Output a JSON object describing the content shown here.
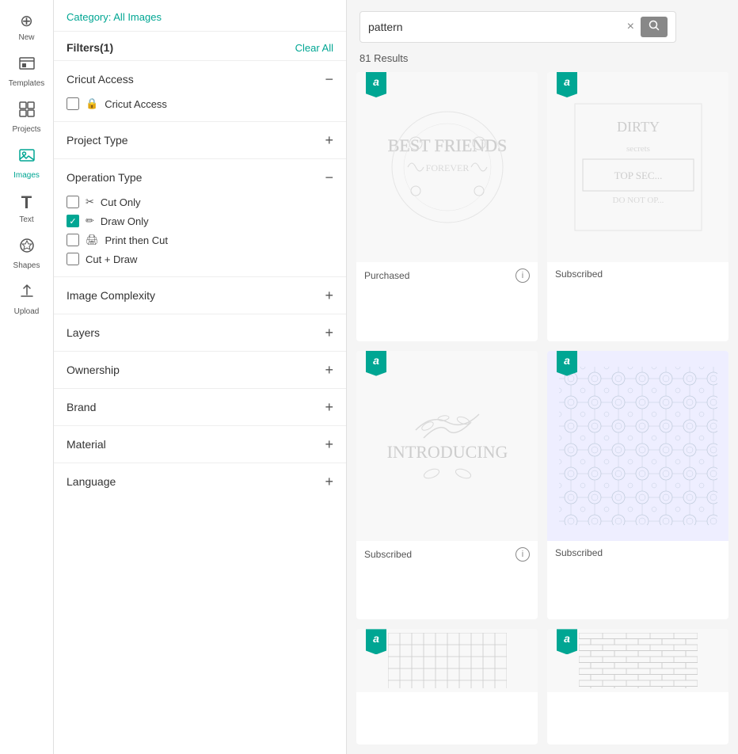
{
  "sidebar": {
    "items": [
      {
        "id": "new",
        "label": "New",
        "icon": "⊕",
        "active": false
      },
      {
        "id": "templates",
        "label": "Templates",
        "icon": "👕",
        "active": false
      },
      {
        "id": "projects",
        "label": "Projects",
        "icon": "⊞",
        "active": false
      },
      {
        "id": "images",
        "label": "Images",
        "icon": "🖼",
        "active": true
      },
      {
        "id": "text",
        "label": "Text",
        "icon": "T",
        "active": false
      },
      {
        "id": "shapes",
        "label": "Shapes",
        "icon": "✦",
        "active": false
      },
      {
        "id": "upload",
        "label": "Upload",
        "icon": "⬆",
        "active": false
      }
    ]
  },
  "category_bar": {
    "prefix": "Category: ",
    "value": "All Images"
  },
  "filters": {
    "header": "Filters(1)",
    "clear_all": "Clear All",
    "sections": [
      {
        "id": "cricut-access",
        "title": "Cricut Access",
        "expanded": true,
        "toggle": "−",
        "options": [
          {
            "label": "Cricut Access",
            "checked": false,
            "has_lock": true
          }
        ]
      },
      {
        "id": "project-type",
        "title": "Project Type",
        "expanded": false,
        "toggle": "+"
      },
      {
        "id": "operation-type",
        "title": "Operation Type",
        "expanded": true,
        "toggle": "−",
        "options": [
          {
            "label": "Cut Only",
            "checked": false,
            "icon": "✂"
          },
          {
            "label": "Draw Only",
            "checked": true,
            "icon": "✏"
          },
          {
            "label": "Print then Cut",
            "checked": false,
            "icon": "🖨"
          },
          {
            "label": "Cut + Draw",
            "checked": false,
            "icon": ""
          }
        ]
      },
      {
        "id": "image-complexity",
        "title": "Image Complexity",
        "expanded": false,
        "toggle": "+"
      },
      {
        "id": "layers",
        "title": "Layers",
        "expanded": false,
        "toggle": "+"
      },
      {
        "id": "ownership",
        "title": "Ownership",
        "expanded": false,
        "toggle": "+"
      },
      {
        "id": "brand",
        "title": "Brand",
        "expanded": false,
        "toggle": "+"
      },
      {
        "id": "material",
        "title": "Material",
        "expanded": false,
        "toggle": "+"
      },
      {
        "id": "language",
        "title": "Language",
        "expanded": false,
        "toggle": "+"
      }
    ]
  },
  "search": {
    "value": "pattern",
    "placeholder": "Search",
    "results_count": "81 Results",
    "clear_label": "×",
    "search_icon": "🔍"
  },
  "images": [
    {
      "id": 1,
      "status": "Purchased",
      "has_info": true,
      "type": "best-friends"
    },
    {
      "id": 2,
      "status": "Subscribed",
      "has_info": false,
      "type": "dirty-secrets"
    },
    {
      "id": 3,
      "status": "Subscribed",
      "has_info": true,
      "type": "introducing"
    },
    {
      "id": 4,
      "status": "Subscribed",
      "has_info": false,
      "type": "lace-pattern"
    },
    {
      "id": 5,
      "status": "",
      "has_info": false,
      "type": "grid-pattern"
    },
    {
      "id": 6,
      "status": "",
      "has_info": false,
      "type": "brick-pattern"
    }
  ],
  "colors": {
    "accent": "#00a693",
    "text_primary": "#333",
    "text_secondary": "#555",
    "border": "#e0e0e0"
  }
}
